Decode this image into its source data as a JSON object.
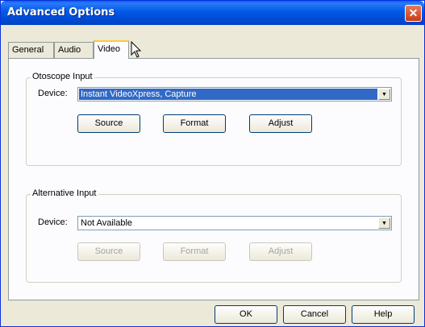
{
  "window": {
    "title": "Advanced Options",
    "close_glyph": "✕"
  },
  "tabs": [
    {
      "label": "General",
      "active": false
    },
    {
      "label": "Audio",
      "active": false
    },
    {
      "label": "Video",
      "active": true
    }
  ],
  "otoscope": {
    "group_label": "Otoscope Input",
    "device_label": "Device:",
    "device_value": "Instant VideoXpress, Capture",
    "buttons": {
      "source": "Source",
      "format": "Format",
      "adjust": "Adjust"
    }
  },
  "alternative": {
    "group_label": "Alternative Input",
    "device_label": "Device:",
    "device_value": "Not Available",
    "buttons": {
      "source": "Source",
      "format": "Format",
      "adjust": "Adjust"
    },
    "buttons_disabled": true
  },
  "footer": {
    "ok": "OK",
    "cancel": "Cancel",
    "help": "Help"
  },
  "icons": {
    "dropdown": "chevron-down-icon",
    "close": "close-icon",
    "cursor": "mouse-pointer-icon"
  },
  "colors": {
    "titlebar": "#0058e6",
    "selection": "#316ac5",
    "active_tab_accent": "#ffc83c"
  }
}
